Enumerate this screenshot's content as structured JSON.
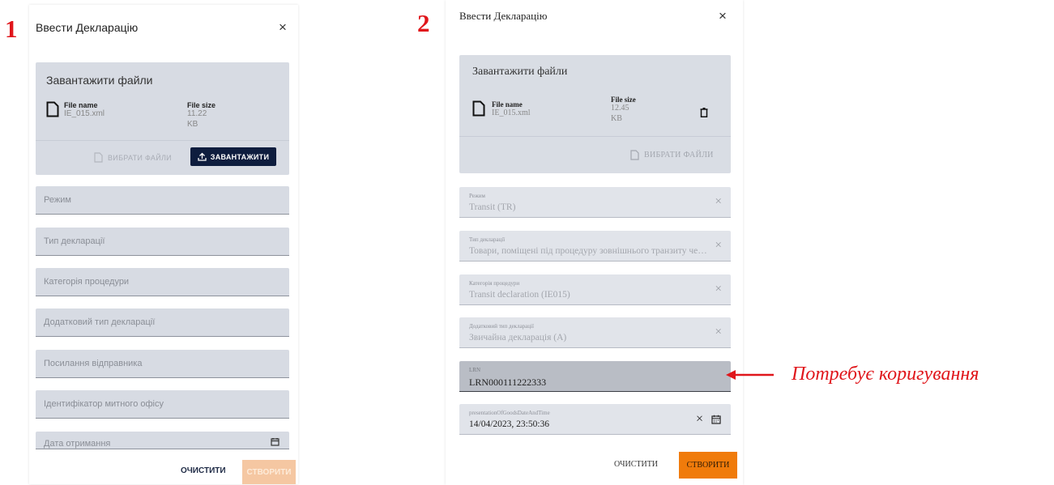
{
  "labels": {
    "n1": "1",
    "n2": "2",
    "annotation": "Потребує коригування"
  },
  "colors": {
    "accent_red": "#e0161b",
    "upload_button": "#0e1d3e",
    "create_button": "#f07b0b",
    "field_bg": "#d7dbe3"
  },
  "icons": {
    "file": "file-icon",
    "close": "close-icon",
    "upload": "upload-icon",
    "delete": "trash-icon",
    "calendar": "calendar-icon"
  },
  "screen1": {
    "title": "Ввести Декларацію",
    "close": "×",
    "upload": {
      "title": "Завантажити файли",
      "file_name_label": "File name",
      "file_name": "IE_015.xml",
      "file_size_label": "File size",
      "file_size_value": "11.22",
      "file_size_unit": "KB",
      "pick_label": "ВИБРАТИ ФАЙЛИ",
      "upload_label": "ЗАВАНТАЖИТИ"
    },
    "fields": [
      {
        "placeholder": "Режим"
      },
      {
        "placeholder": "Тип декларації"
      },
      {
        "placeholder": "Категорія процедури"
      },
      {
        "placeholder": "Додатковий тип декларації"
      },
      {
        "placeholder": "Посилання відправника"
      },
      {
        "placeholder": "Ідентифікатор митного офісу"
      },
      {
        "placeholder": "Дата отримання"
      }
    ],
    "clear_label": "ОЧИСТИТИ",
    "create_label": "СТВОРИТИ"
  },
  "screen2": {
    "title": "Ввести Декларацію",
    "close": "×",
    "upload": {
      "title": "Завантажити файли",
      "file_name_label": "File name",
      "file_name": "IE_015.xml",
      "file_size_label": "File size",
      "file_size_value": "12.45",
      "file_size_unit": "KB",
      "pick_label": "ВИБРАТИ ФАЙЛИ"
    },
    "fields": [
      {
        "label": "Режим",
        "value": "Transit (TR)",
        "clear": "×"
      },
      {
        "label": "Тип декларації",
        "value": "Товари, поміщені під процедуру зовнішнього транзиту через ...",
        "clear": "×"
      },
      {
        "label": "Категорія процедури",
        "value": "Transit declaration (IE015)",
        "clear": "×"
      },
      {
        "label": "Додатковий тип декларації",
        "value": "Звичайна декларація (A)",
        "clear": "×"
      },
      {
        "label": "LRN",
        "value": "LRN000111222333"
      },
      {
        "label": "presentationOfGoodsDateAndTime",
        "value": "14/04/2023, 23:50:36",
        "clear": "×"
      }
    ],
    "clear_label": "ОЧИСТИТИ",
    "create_label": "СТВОРИТИ"
  }
}
